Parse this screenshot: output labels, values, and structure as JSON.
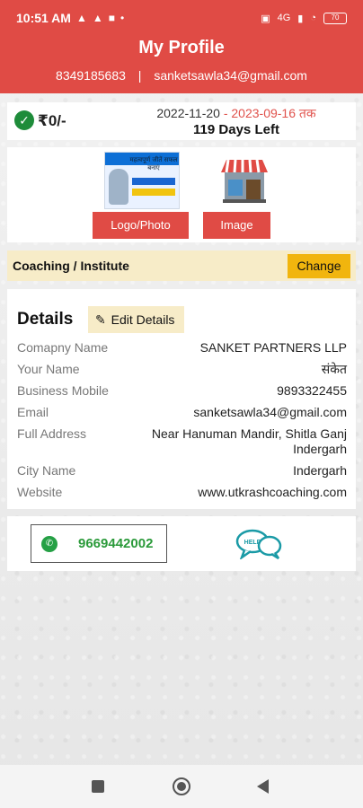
{
  "status_bar": {
    "time": "10:51 AM",
    "network": "4G",
    "battery": "70"
  },
  "header": {
    "title": "My Profile",
    "phone": "8349185683",
    "separator": "|",
    "email": "sanketsawla34@gmail.com"
  },
  "plan": {
    "price": "₹0/-",
    "start_date": "2022-11-20",
    "date_separator": " - ",
    "end_date": "2023-09-16 तक",
    "days_left": "119 Days Left"
  },
  "media": {
    "logo_thumb_text": "महत्वपूर्ण जीतें सफल बनाएं",
    "logo_button": "Logo/Photo",
    "image_button": "Image"
  },
  "category": {
    "label": "Coaching / Institute",
    "change_button": "Change"
  },
  "details": {
    "title": "Details",
    "edit_button": "Edit Details",
    "rows": [
      {
        "label": "Comapny Name",
        "value": "SANKET PARTNERS LLP"
      },
      {
        "label": "Your Name",
        "value": "संकेत"
      },
      {
        "label": "Business Mobile",
        "value": "9893322455"
      },
      {
        "label": "Email",
        "value": "sanketsawla34@gmail.com"
      },
      {
        "label": "Full Address",
        "value": "Near Hanuman Mandir, Shitla Ganj Indergarh"
      },
      {
        "label": "City Name",
        "value": "Indergarh"
      },
      {
        "label": "Website",
        "value": "www.utkrashcoaching.com"
      }
    ]
  },
  "contact": {
    "whatsapp_number": "9669442002",
    "help_label": "HELP"
  },
  "colors": {
    "header": "#e04b45",
    "accent_button": "#f1b50e",
    "highlight_bg": "#f7ecc8",
    "whatsapp_green": "#2b9a3a",
    "end_date_red": "#e0514b"
  }
}
